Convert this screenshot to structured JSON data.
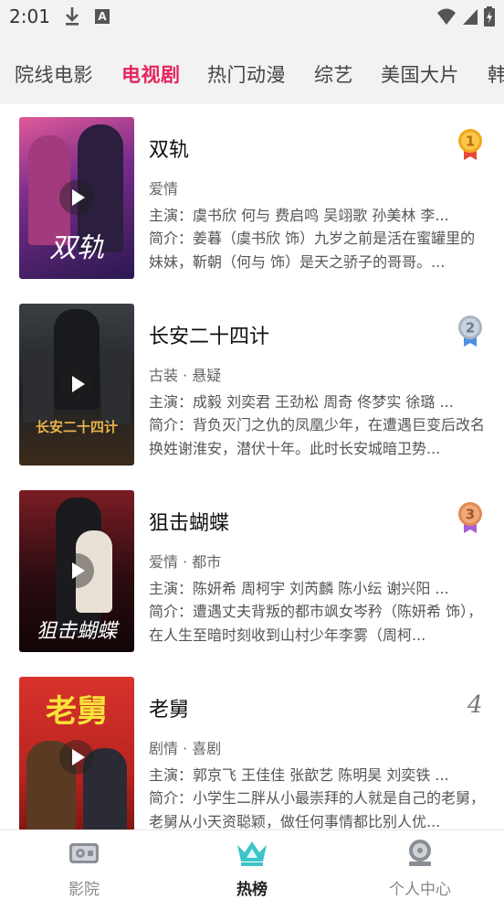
{
  "status_bar": {
    "time": "2:01",
    "badge_letter": "A"
  },
  "tabs": [
    {
      "label": "院线电影",
      "active": false
    },
    {
      "label": "电视剧",
      "active": true
    },
    {
      "label": "热门动漫",
      "active": false
    },
    {
      "label": "综艺",
      "active": false
    },
    {
      "label": "美国大片",
      "active": false
    },
    {
      "label": "韩",
      "active": false
    }
  ],
  "items": [
    {
      "rank": "1",
      "title": "双轨",
      "genre": "爱情",
      "cast": "主演：虞书欣 何与 费启鸣 吴翊歌 孙美林 李...",
      "intro": "简介：姜暮（虞书欣 饰）九岁之前是活在蜜罐里的妹妹，靳朝（何与 饰）是天之骄子的哥哥。...",
      "poster_text": "双轨"
    },
    {
      "rank": "2",
      "title": "长安二十四计",
      "genre": "古装 · 悬疑",
      "cast": "主演：成毅 刘奕君 王劲松 周奇 佟梦实 徐璐 ...",
      "intro": "简介：背负灭门之仇的凤凰少年，在遭遇巨变后改名换姓谢淮安，潜伏十年。此时长安城暗卫势...",
      "poster_text": "长安二十四计"
    },
    {
      "rank": "3",
      "title": "狙击蝴蝶",
      "genre": "爱情 · 都市",
      "cast": "主演：陈妍希 周柯宇 刘芮麟 陈小纭 谢兴阳 ...",
      "intro": "简介：遭遇丈夫背叛的都市飒女岑矜（陈妍希 饰），在人生至暗时刻收到山村少年李雾（周柯...",
      "poster_text": "狙击蝴蝶"
    },
    {
      "rank": "4",
      "title": "老舅",
      "genre": "剧情 · 喜剧",
      "cast": "主演：郭京飞 王佳佳 张歆艺 陈明昊 刘奕铁 ...",
      "intro": "简介：小学生二胖从小最崇拜的人就是自己的老舅，老舅从小天资聪颖，做任何事情都比别人优...",
      "poster_text": "老舅"
    }
  ],
  "bottom_nav": [
    {
      "label": "影院",
      "icon": "cinema-icon",
      "active": false
    },
    {
      "label": "热榜",
      "icon": "crown-icon",
      "active": true
    },
    {
      "label": "个人中心",
      "icon": "profile-icon",
      "active": false
    }
  ],
  "colors": {
    "accent": "#e5255c",
    "gold": "#f2a61a",
    "silver": "#a8b4c4",
    "bronze": "#e08a55",
    "crown": "#3cc4c9"
  }
}
